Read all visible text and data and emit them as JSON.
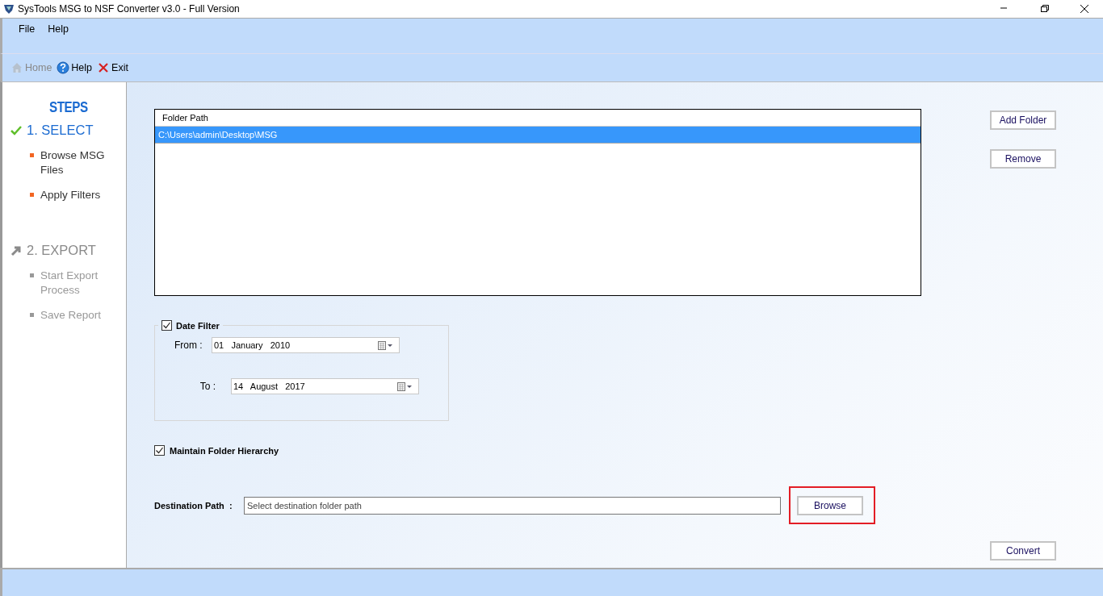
{
  "window": {
    "title": "SysTools MSG to NSF Converter v3.0 - Full Version"
  },
  "menu": [
    "File",
    "Help"
  ],
  "toolbar": [
    {
      "kind": "home",
      "label": "Home",
      "disabled": true
    },
    {
      "kind": "help",
      "label": "Help",
      "disabled": false
    },
    {
      "kind": "exit",
      "label": "Exit",
      "disabled": false
    }
  ],
  "steps": {
    "heading": "STEPS",
    "items": [
      {
        "label": "1. SELECT",
        "done": true,
        "substeps": [
          {
            "label": "Browse MSG Files",
            "active": true
          },
          {
            "label": "Apply Filters",
            "active": true
          }
        ]
      },
      {
        "label": "2. EXPORT",
        "done": false,
        "substeps": [
          {
            "label": "Start Export Process",
            "active": false
          },
          {
            "label": "Save Report",
            "active": false
          }
        ]
      }
    ]
  },
  "folder_list": {
    "columns": [
      "Folder Path"
    ],
    "rows": [
      {
        "path": "C:\\Users\\admin\\Desktop\\MSG",
        "selected": true
      }
    ]
  },
  "side_buttons": [
    "Add Folder",
    "Remove"
  ],
  "date_filter": {
    "label": "Date Filter",
    "checked": true,
    "fields": [
      {
        "label": "From :",
        "value": "01   January   2010"
      },
      {
        "label": "To :",
        "value": "14   August   2017"
      }
    ]
  },
  "hierarchy": {
    "label": "Maintain Folder Hierarchy",
    "checked": true
  },
  "destination": {
    "label": "Destination Path  :",
    "placeholder": "Select destination folder path",
    "button": "Browse",
    "highlighted": true
  },
  "convert_button": "Convert"
}
